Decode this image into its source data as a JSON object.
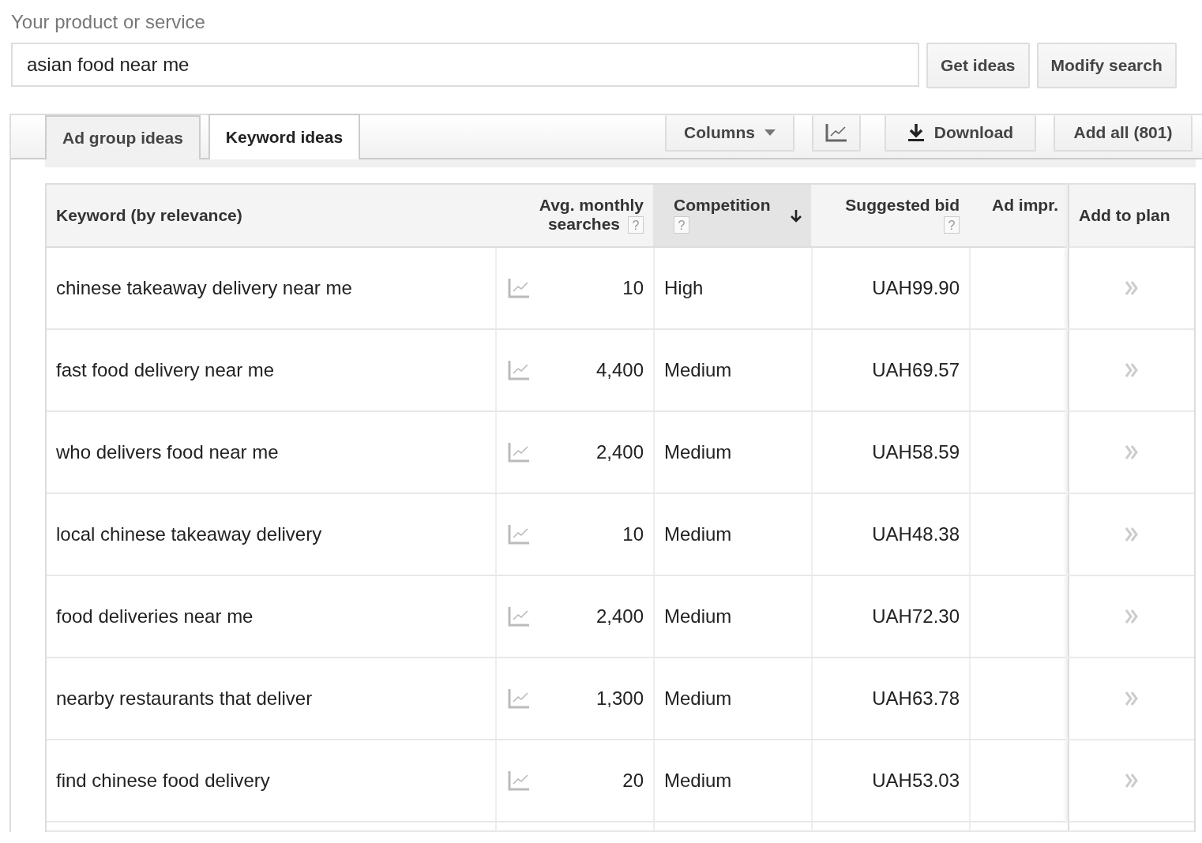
{
  "search": {
    "label": "Your product or service",
    "value": "asian food near me"
  },
  "search_buttons": [
    "Get ideas",
    "Modify search"
  ],
  "tabs": [
    {
      "label": "Ad group ideas",
      "selected": false
    },
    {
      "label": "Keyword ideas",
      "selected": true
    }
  ],
  "toolbar": {
    "columns": "Columns",
    "download": "Download",
    "add_all": "Add all (801)"
  },
  "table": {
    "columns": [
      {
        "label": "Keyword (by relevance)",
        "sorted": false
      },
      {
        "label": "Avg. monthly searches",
        "help": "?",
        "sorted": false
      },
      {
        "label": "Competition",
        "help": "?",
        "sorted": true
      },
      {
        "label": "Suggested bid",
        "help": "?",
        "sorted": false
      },
      {
        "label": "Ad impr.",
        "sorted": false
      },
      {
        "label": "Add to plan",
        "sorted": false
      }
    ],
    "rows": [
      {
        "keyword": "chinese takeaway delivery near me",
        "searches": "10",
        "competition": "High",
        "bid": "UAH99.90"
      },
      {
        "keyword": "fast food delivery near me",
        "searches": "4,400",
        "competition": "Medium",
        "bid": "UAH69.57"
      },
      {
        "keyword": "who delivers food near me",
        "searches": "2,400",
        "competition": "Medium",
        "bid": "UAH58.59"
      },
      {
        "keyword": "local chinese takeaway delivery",
        "searches": "10",
        "competition": "Medium",
        "bid": "UAH48.38"
      },
      {
        "keyword": "food deliveries near me",
        "searches": "2,400",
        "competition": "Medium",
        "bid": "UAH72.30"
      },
      {
        "keyword": "nearby restaurants that deliver",
        "searches": "1,300",
        "competition": "Medium",
        "bid": "UAH63.78"
      },
      {
        "keyword": "find chinese food delivery",
        "searches": "20",
        "competition": "Medium",
        "bid": "UAH53.03"
      }
    ]
  }
}
